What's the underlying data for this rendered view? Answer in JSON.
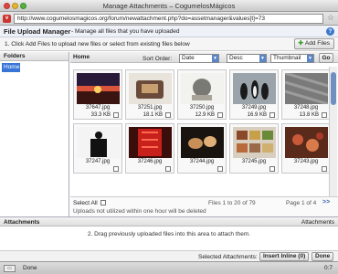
{
  "window": {
    "title": "Manage Attachments – CogumelosMágicos"
  },
  "browser": {
    "url": "http://www.cogumelosmagicos.org/forum/newattachment.php?do=assetmanager&values[t]=73",
    "status": "Done",
    "status_right": "0:7"
  },
  "header": {
    "title": "File Upload Manager",
    "subtitle": "- Manage all files that you have uploaded"
  },
  "instructions": {
    "text": "1. Click Add Files to upload new files or select from existing files below",
    "add_button": "Add Files"
  },
  "folders": {
    "header": "Folders",
    "items": [
      "Home"
    ]
  },
  "main": {
    "path": "Home",
    "sort_label": "Sort Order:",
    "sort_by": "Date",
    "sort_dir": "Desc",
    "view": "Thumbnail",
    "go": "Go"
  },
  "thumbs": [
    {
      "name": "37647.jpg",
      "size": "33.3 KB"
    },
    {
      "name": "37251.jpg",
      "size": "18.1 KB"
    },
    {
      "name": "37250.jpg",
      "size": "12.9 KB"
    },
    {
      "name": "37249.jpg",
      "size": "16.9 KB"
    },
    {
      "name": "37248.jpg",
      "size": "13.8 KB"
    },
    {
      "name": "37247.jpg",
      "size": ""
    },
    {
      "name": "37246.jpg",
      "size": ""
    },
    {
      "name": "37244.jpg",
      "size": ""
    },
    {
      "name": "37245.jpg",
      "size": ""
    },
    {
      "name": "37243.jpg",
      "size": ""
    }
  ],
  "footer": {
    "select_all": "Select All",
    "files_count": "Files 1 to 20 of 79",
    "page_info": "Page 1 of 4",
    "page_next": ">>",
    "note": "Uploads not utilized within one hour will be deleted"
  },
  "attachments": {
    "title": "Attachments",
    "right_label": "Attachments",
    "drag_text": "2. Drag previously uploaded files into this area to attach them.",
    "selected_label": "Selected Attachments:",
    "insert_button": "Insert Inline (0)",
    "done_button": "Done"
  },
  "colors": {
    "accent": "#3875d7",
    "header_bg": "#eef2f8"
  }
}
